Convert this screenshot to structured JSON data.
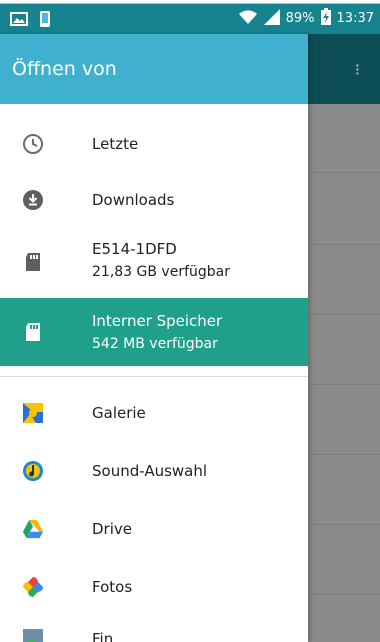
{
  "status_bar": {
    "battery_percent": "89%",
    "time": "13:37",
    "icons": [
      "image-icon",
      "phone-icon",
      "wifi-icon",
      "signal-icon",
      "battery-charging-icon"
    ]
  },
  "drawer": {
    "title": "Öffnen von",
    "items": [
      {
        "label": "Letzte",
        "icon": "clock-icon"
      },
      {
        "label": "Downloads",
        "icon": "download-icon"
      },
      {
        "label": "E514-1DFD",
        "sub": "21,83 GB verfügbar",
        "icon": "sd-card-icon"
      },
      {
        "label": "Interner Speicher",
        "sub": "542 MB verfügbar",
        "icon": "sd-card-icon",
        "selected": true
      },
      {
        "label": "Galerie",
        "icon": "gallery-icon"
      },
      {
        "label": "Sound-Auswahl",
        "icon": "sound-picker-icon"
      },
      {
        "label": "Drive",
        "icon": "drive-icon"
      },
      {
        "label": "Fotos",
        "icon": "photos-icon"
      },
      {
        "label": "Fin",
        "icon": "app-icon"
      }
    ]
  },
  "colors": {
    "status_bar": "#17838f",
    "header": "#3fb0ce",
    "selected": "#1fa08a"
  }
}
